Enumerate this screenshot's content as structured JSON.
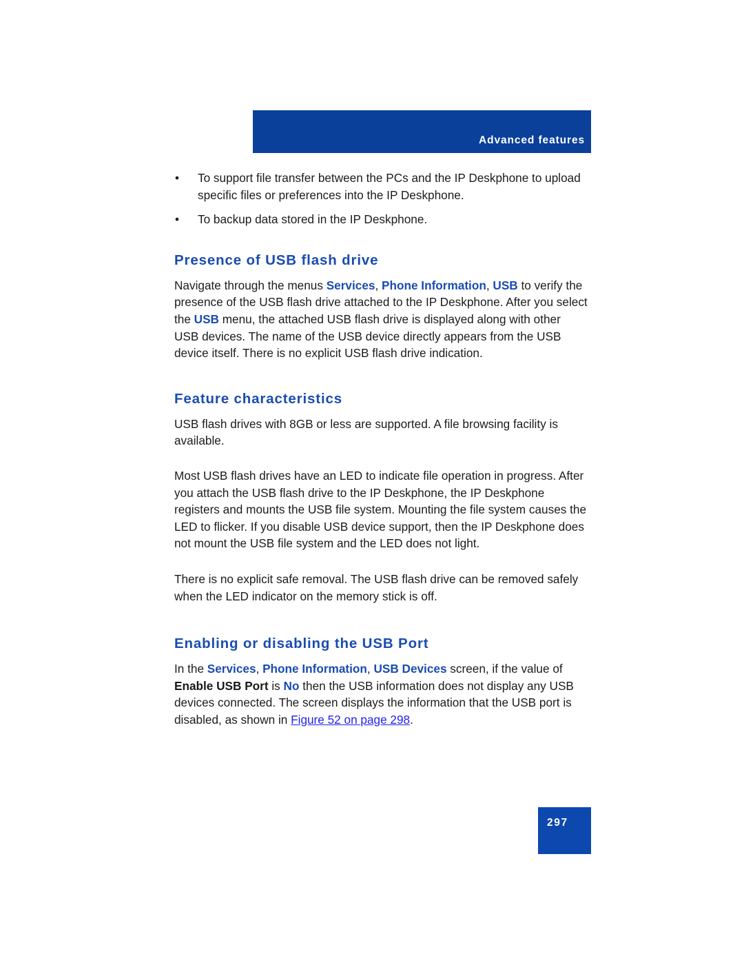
{
  "header": {
    "running_title": "Advanced features"
  },
  "bullets": [
    "To support file transfer between the PCs and the IP Deskphone to upload specific files or preferences into the IP Deskphone.",
    "To backup data stored in the IP Deskphone.",
    "•"
  ],
  "bullet_marker": "•",
  "sections": [
    {
      "heading": "Presence of USB flash drive",
      "paragraph_parts": {
        "p1_a": "Navigate through the menus ",
        "p1_term1": "Services",
        "p1_b": ", ",
        "p1_term2": "Phone Information",
        "p1_c": ", ",
        "p1_term3": "USB",
        "p1_d": " to verify the presence of the USB flash drive attached to the IP Deskphone. After you select the ",
        "p1_term4": "USB",
        "p1_e": " menu, the attached USB flash drive is displayed along with other USB devices. The name of the USB device directly appears from the USB device itself. There is no explicit USB flash drive indication."
      }
    },
    {
      "heading": "Feature characteristics",
      "p1": "USB flash drives with 8GB or less are supported. A file browsing facility is available.",
      "p2": "Most USB flash drives have an LED to indicate file operation in progress. After you attach the USB flash drive to the IP Deskphone, the IP Deskphone registers and mounts the USB file system. Mounting the file system causes the LED to flicker. If you disable USB device support, then the IP Deskphone does not mount the USB file system and the LED does not light.",
      "p3": "There is no explicit safe removal. The USB flash drive can be removed safely when the LED indicator on the memory stick is off."
    },
    {
      "heading": "Enabling or disabling the USB Port",
      "paragraph_parts": {
        "p1_a": "In the ",
        "p1_term1": "Services",
        "p1_b": ", ",
        "p1_term2": "Phone Information",
        "p1_c": ", ",
        "p1_term3": "USB Devices",
        "p1_d": " screen, if the value of ",
        "p1_bold1": "Enable USB Port",
        "p1_e": " is ",
        "p1_term4": "No",
        "p1_f": " then the USB information does not display any USB devices connected. The screen displays the information that the USB port is disabled, as shown in ",
        "p1_xref": "Figure 52 on page 298",
        "p1_g": "."
      }
    }
  ],
  "footer": {
    "page_number": "297"
  },
  "colors": {
    "header_bar_blue": "#0a4099",
    "heading_blue": "#1a4cb0",
    "link_blue": "#2222ee",
    "page_box_blue": "#0d48ae",
    "body_text": "#1c1c1c"
  }
}
